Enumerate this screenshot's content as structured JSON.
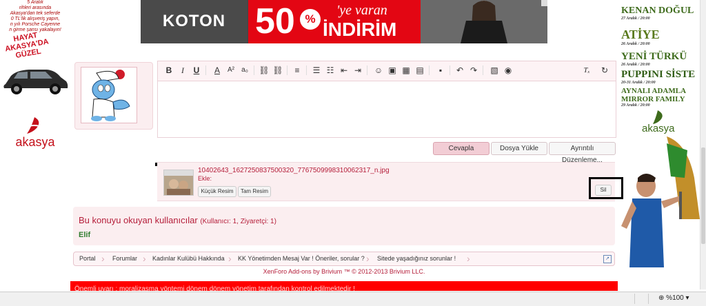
{
  "left_ad": {
    "lines": [
      "5 Aralık",
      "rihleri arasında",
      "Akasya'dan tek seferde",
      "0 TL'lik alışveriş yapın,",
      "n yılı Porsche Cayenne",
      "n girme şansı yakalayın!"
    ],
    "hayat": "HAYAT AKASYA'DA GÜZEL",
    "brand": "akasya"
  },
  "banner": {
    "brand": "KOTON",
    "number": "50",
    "percent": "%",
    "tagline": "'ye varan",
    "headline": "İNDİRİM"
  },
  "right_ad": {
    "acts": [
      {
        "name": "KENAN DOĞUL",
        "date": "27 Aralık / 20:00"
      },
      {
        "name": "ATİYE",
        "date": "26 Aralık / 20:00"
      },
      {
        "name": "YENİ TÜRKÜ",
        "date": "26 Aralık / 20:00"
      },
      {
        "name": "PUPPINI SİSTE",
        "date": "20-31 Aralık / 20:00"
      },
      {
        "name": "AYNALI ADAMLA",
        "date": ""
      },
      {
        "name": "MIRROR FAMILY",
        "date": "29 Aralık / 20:00"
      }
    ],
    "brand": "akasya"
  },
  "editor": {
    "toolbar": [
      {
        "name": "bold-button",
        "glyph": "B",
        "style": "b"
      },
      {
        "name": "italic-button",
        "glyph": "I",
        "style": "i"
      },
      {
        "name": "underline-button",
        "glyph": "U",
        "style": "u"
      },
      {
        "name": "font-color-button",
        "glyph": "A",
        "style": ""
      },
      {
        "name": "font-size-button",
        "glyph": "A²",
        "style": ""
      },
      {
        "name": "font-family-button",
        "glyph": "a₀",
        "style": ""
      },
      {
        "name": "link-button",
        "glyph": "⛓",
        "style": ""
      },
      {
        "name": "unlink-button",
        "glyph": "⛓",
        "style": ""
      },
      {
        "name": "align-button",
        "glyph": "≡",
        "style": ""
      },
      {
        "name": "bullet-list-button",
        "glyph": "☰",
        "style": ""
      },
      {
        "name": "numbered-list-button",
        "glyph": "☷",
        "style": ""
      },
      {
        "name": "outdent-button",
        "glyph": "⇤",
        "style": ""
      },
      {
        "name": "indent-button",
        "glyph": "⇥",
        "style": ""
      },
      {
        "name": "smilie-button",
        "glyph": "☺",
        "style": ""
      },
      {
        "name": "image-button",
        "glyph": "▣",
        "style": ""
      },
      {
        "name": "media-button",
        "glyph": "▦",
        "style": ""
      },
      {
        "name": "insert-button",
        "glyph": "▤",
        "style": ""
      },
      {
        "name": "save-draft-button",
        "glyph": "▪",
        "style": ""
      },
      {
        "name": "undo-button",
        "glyph": "↶",
        "style": ""
      },
      {
        "name": "redo-button",
        "glyph": "↷",
        "style": ""
      },
      {
        "name": "image-upload-button",
        "glyph": "▧",
        "style": ""
      },
      {
        "name": "camera-button",
        "glyph": "◉",
        "style": ""
      },
      {
        "name": "remove-format-button",
        "glyph": "Tₓ",
        "style": "i"
      },
      {
        "name": "toggle-bbcode-button",
        "glyph": "↻",
        "style": ""
      }
    ],
    "reply_label": "Cevapla",
    "upload_label": "Dosya Yükle",
    "advanced_label": "Ayrıntılı Düzenleme..."
  },
  "attachment": {
    "filename": "10402643_1627250837500320_7767509998310062317_n.jpg",
    "insert_label": "Ekle:",
    "thumb_label": "Küçük Resim",
    "full_label": "Tam Resim",
    "delete_label": "Sil"
  },
  "readers": {
    "title": "Bu konuyu okuyan kullanıcılar",
    "count": "(Kullanıcı: 1, Ziyaretçi: 1)",
    "user": "Elif"
  },
  "breadcrumb": [
    "Portal",
    "Forumlar",
    "Kadınlar Kulübü Hakkında",
    "KK Yönetimden Mesaj Var ! Öneriler, sorular ?",
    "Sitede yaşadığınız sorunlar !"
  ],
  "credit": "XenForo Add-ons by Brivium ™ © 2012-2013 Brivium LLC.",
  "notice": "Önemli uyarı : moralizasma yöntemi dönem dönem yönetim tarafından kontrol edilmektedir !",
  "status": {
    "zoom": "%100"
  },
  "colors": {
    "accent": "#b51e3a",
    "panel": "#fbeef0",
    "notice_bg": "#ff0000"
  }
}
